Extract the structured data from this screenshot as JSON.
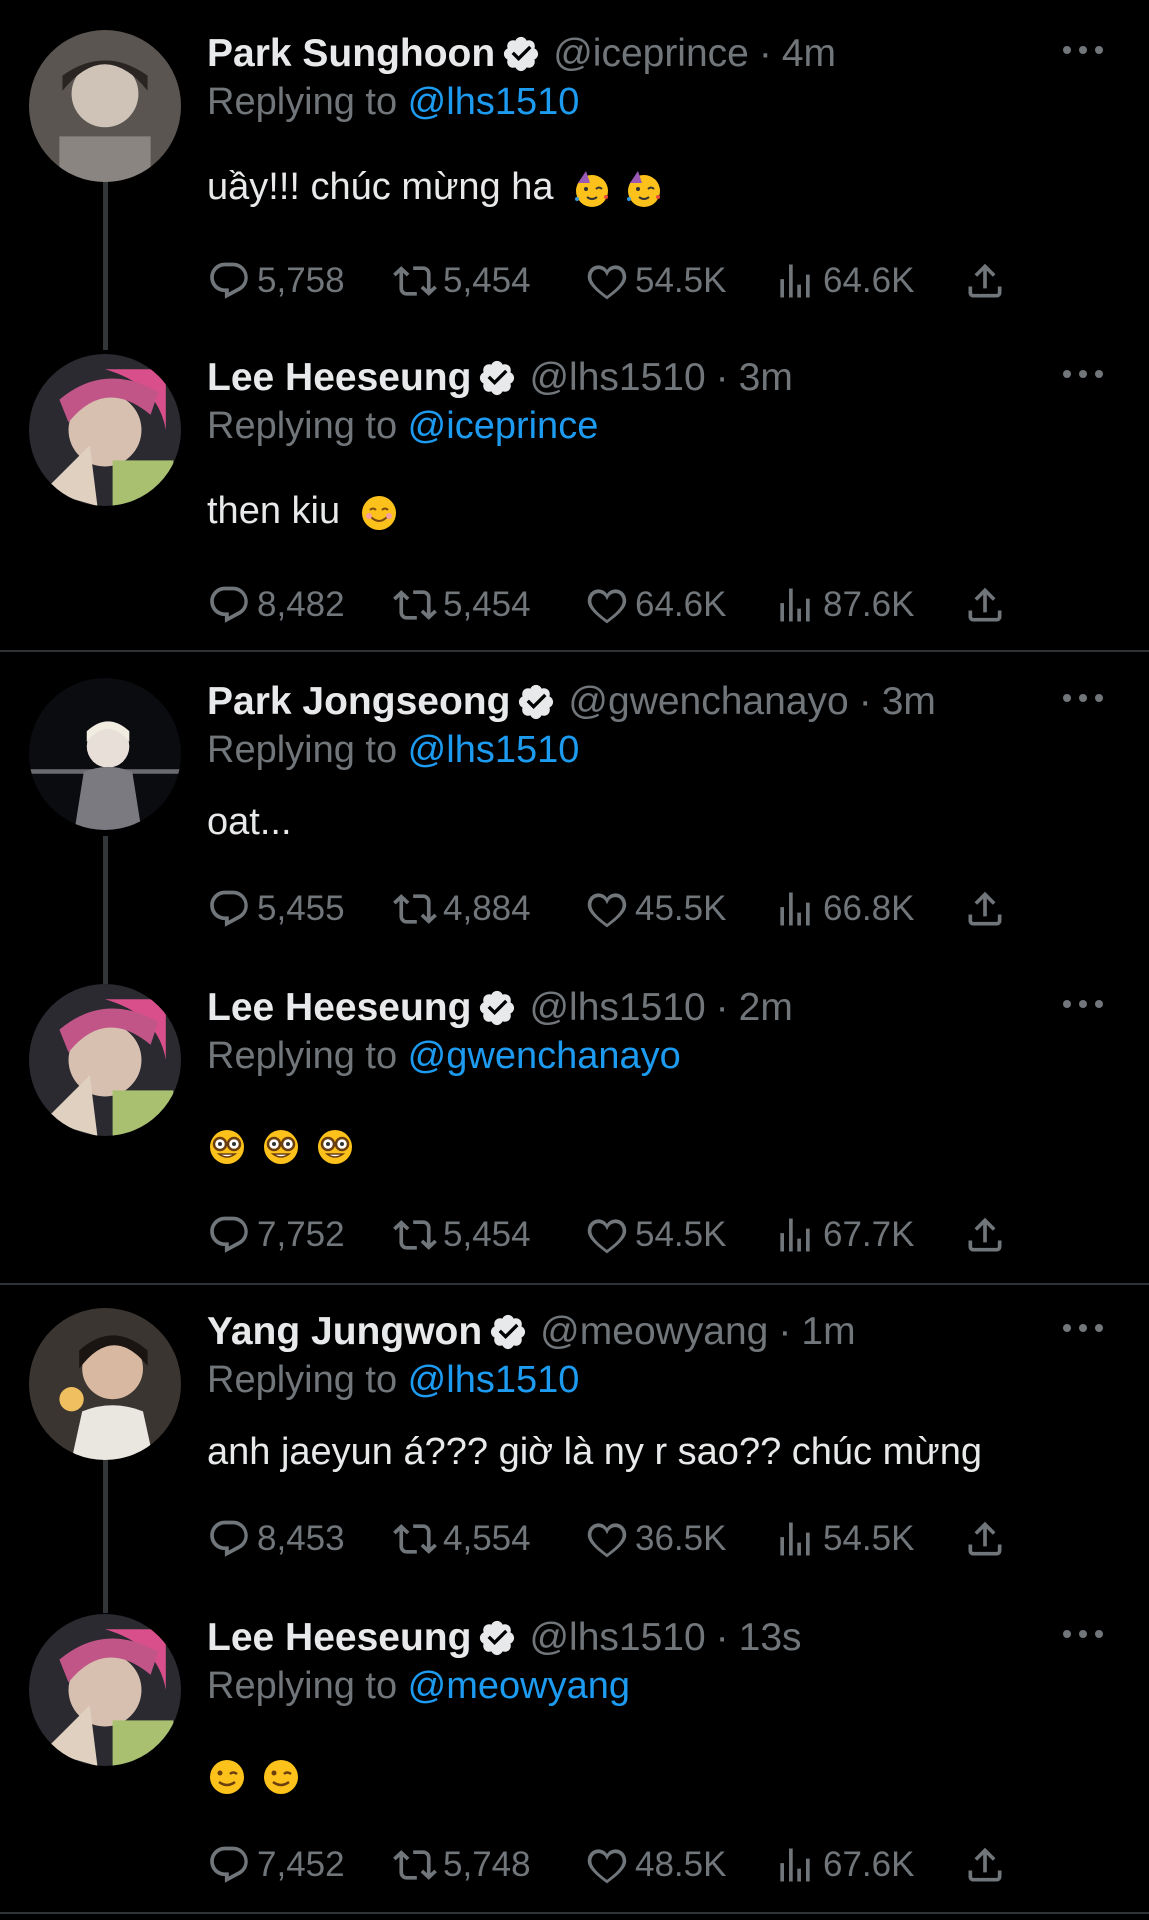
{
  "tweets": [
    {
      "name": "Park Sunghoon",
      "handle": "@iceprince",
      "separator": "·",
      "time": "4m",
      "reply_prefix": "Replying to ",
      "reply_to": "@lhs1510",
      "text": "uầy!!! chúc mừng ha",
      "emojis": [
        "partying-face-emoji",
        "partying-face-emoji"
      ],
      "stats": {
        "replies": "5,758",
        "retweets": "5,454",
        "likes": "54.5K",
        "views": "64.6K"
      }
    },
    {
      "name": "Lee Heeseung",
      "handle": "@lhs1510",
      "separator": "·",
      "time": "3m",
      "reply_prefix": "Replying to ",
      "reply_to": "@iceprince",
      "text": "then kiu",
      "emojis": [
        "smiling-face-emoji"
      ],
      "stats": {
        "replies": "8,482",
        "retweets": "5,454",
        "likes": "64.6K",
        "views": "87.6K"
      }
    },
    {
      "name": "Park Jongseong",
      "handle": "@gwenchanayo",
      "separator": "·",
      "time": "3m",
      "reply_prefix": "Replying to ",
      "reply_to": "@lhs1510",
      "text": "oat...",
      "emojis": [],
      "stats": {
        "replies": "5,455",
        "retweets": "4,884",
        "likes": "45.5K",
        "views": "66.8K"
      }
    },
    {
      "name": "Lee Heeseung",
      "handle": "@lhs1510",
      "separator": "·",
      "time": "2m",
      "reply_prefix": "Replying to ",
      "reply_to": "@gwenchanayo",
      "text": "",
      "emojis": [
        "nerd-face-emoji",
        "nerd-face-emoji",
        "nerd-face-emoji"
      ],
      "stats": {
        "replies": "7,752",
        "retweets": "5,454",
        "likes": "54.5K",
        "views": "67.7K"
      }
    },
    {
      "name": "Yang Jungwon",
      "handle": "@meowyang",
      "separator": "·",
      "time": "1m",
      "reply_prefix": "Replying to ",
      "reply_to": "@lhs1510",
      "text": "anh jaeyun á??? giờ là ny r sao?? chúc mừng",
      "emojis": [],
      "stats": {
        "replies": "8,453",
        "retweets": "4,554",
        "likes": "36.5K",
        "views": "54.5K"
      }
    },
    {
      "name": "Lee Heeseung",
      "handle": "@lhs1510",
      "separator": "·",
      "time": "13s",
      "reply_prefix": "Replying to ",
      "reply_to": "@meowyang",
      "text": "",
      "emojis": [
        "winking-face-emoji",
        "winking-face-emoji"
      ],
      "stats": {
        "replies": "7,452",
        "retweets": "5,748",
        "likes": "48.5K",
        "views": "67.6K"
      }
    }
  ],
  "colors": {
    "background": "#000000",
    "text": "#e7e9ea",
    "muted": "#71767b",
    "link": "#1d9bf0",
    "divider": "#2f3336"
  }
}
